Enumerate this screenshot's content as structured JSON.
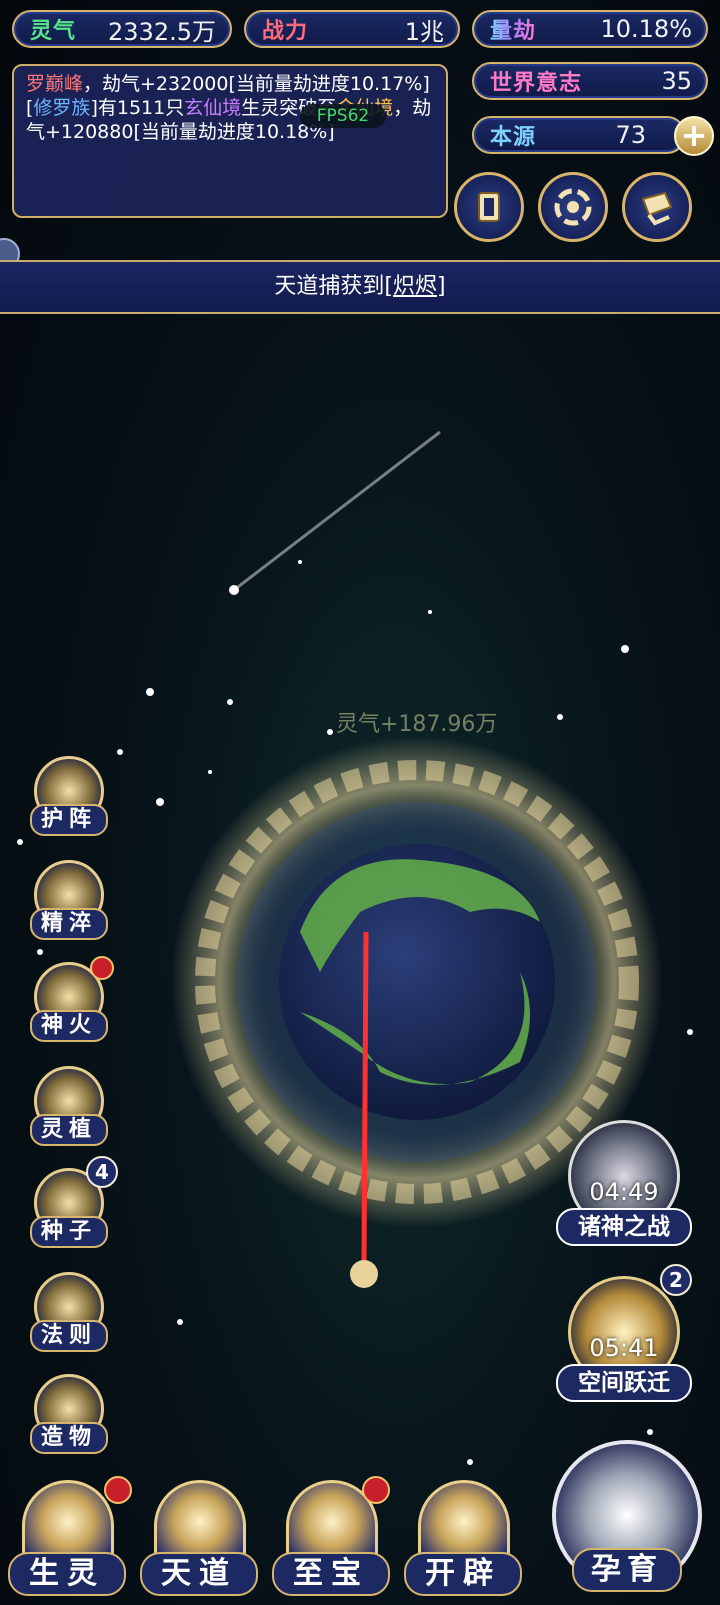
{
  "stats": {
    "lingqi": {
      "label": "灵气",
      "value": "2332.5万"
    },
    "zhanli": {
      "label": "战力",
      "value": "1兆"
    },
    "liangjie": {
      "label": "量劫",
      "value": "10.18%"
    },
    "world_will": {
      "label": "世界意志",
      "value": "35"
    },
    "benyuan": {
      "label": "本源",
      "value": "73"
    }
  },
  "log": {
    "l1_name": "罗巅峰",
    "l1_text": "，劫气+232000[当前量劫进度10.17%]",
    "l2_open": "[",
    "l2_race": "修罗族",
    "l2_a": "]有1511只",
    "l2_realm1": "玄仙境",
    "l2_b": "生灵突破至",
    "l2_realm2": "金仙境",
    "l2_c": "，劫气+120880[当前量劫进度10.18%]",
    "fps": "FPS62"
  },
  "plus_label": "+",
  "banner": {
    "prefix": "天道捕获到",
    "item": "[炽烬]"
  },
  "float_gain": "灵气+187.96万",
  "side_menu": [
    {
      "label": "护阵"
    },
    {
      "label": "精淬"
    },
    {
      "label": "神火"
    },
    {
      "label": "灵植"
    },
    {
      "label": "种子",
      "badge": "4"
    },
    {
      "label": "法则"
    },
    {
      "label": "造物"
    }
  ],
  "events": {
    "war": {
      "timer": "04:49",
      "label": "诸神之战"
    },
    "leap": {
      "timer": "05:41",
      "label": "空间跃迁",
      "badge": "2"
    }
  },
  "bottom_nav": [
    {
      "label": "生灵"
    },
    {
      "label": "天道"
    },
    {
      "label": "至宝"
    },
    {
      "label": "开辟"
    }
  ],
  "breed": {
    "label": "孕育"
  }
}
